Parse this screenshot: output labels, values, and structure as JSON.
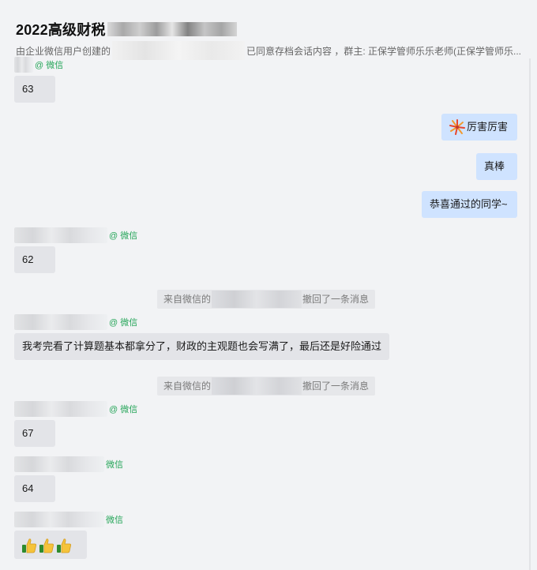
{
  "header": {
    "title": "2022高级财税",
    "subtitle_prefix": "由企业微信用户创建的",
    "subtitle_suffix": "已同意存档会话内容 ，群主: 正保学管师乐乐老师(正保学管师乐..."
  },
  "wechat_tag": "@ 微信",
  "wechat_tag_short": "微信",
  "messages": {
    "m1": {
      "text": "63"
    },
    "m2": {
      "text": "厉害厉害",
      "icon": "firework-icon"
    },
    "m3": {
      "text": "真棒"
    },
    "m4": {
      "text": "恭喜通过的同学~"
    },
    "m5": {
      "text": "62"
    },
    "sys1": {
      "prefix": "来自微信的",
      "suffix": "撤回了一条消息"
    },
    "m6": {
      "text": "我考完看了计算题基本都拿分了，财政的主观题也会写满了，最后还是好险通过"
    },
    "sys2": {
      "prefix": "来自微信的",
      "suffix": "撤回了一条消息"
    },
    "m7": {
      "text": "67"
    },
    "m8": {
      "text": "64"
    },
    "m9": {
      "text": "",
      "icon": "thumbs-up-icon",
      "count": 3
    }
  },
  "colors": {
    "wechat_green": "#27a65a",
    "bubble_left": "#e3e4e8",
    "bubble_right": "#cfe3ff",
    "background": "#f2f3f5"
  }
}
